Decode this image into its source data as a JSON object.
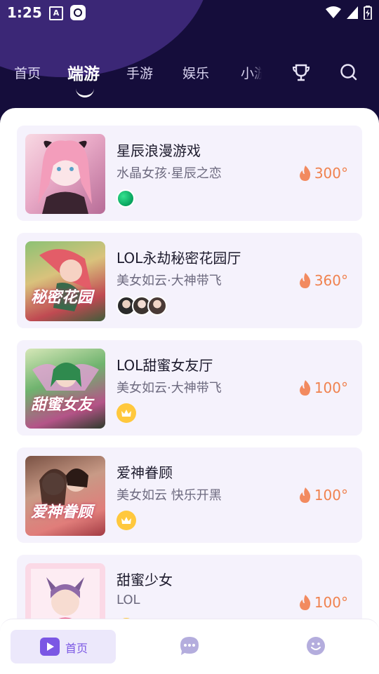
{
  "status_bar": {
    "time": "1:25",
    "app_badge": "A"
  },
  "tabs": [
    {
      "label": "首页",
      "active": false
    },
    {
      "label": "端游",
      "active": true
    },
    {
      "label": "手游",
      "active": false
    },
    {
      "label": "娱乐",
      "active": false
    },
    {
      "label": "小游",
      "active": false
    }
  ],
  "header_icons": [
    "trophy-icon",
    "search-icon"
  ],
  "cards": [
    {
      "title": "星辰浪漫游戏",
      "subtitle": "水晶女孩·星辰之恋",
      "heat": "300°",
      "badge": "green-dot",
      "thumb_colors": [
        "#f4c8d7",
        "#d9a3c7"
      ],
      "thumb_text": ""
    },
    {
      "title": "LOL永劫秘密花园厅",
      "subtitle": "美女如云·大神带飞",
      "heat": "360°",
      "badge": "avatars",
      "thumb_colors": [
        "#7fb06a",
        "#c0524f"
      ],
      "thumb_text": "秘密花园"
    },
    {
      "title": "LOL甜蜜女友厅",
      "subtitle": "美女如云·大神带飞",
      "heat": "100°",
      "badge": "gold-crown",
      "thumb_colors": [
        "#5aa46d",
        "#b4427b"
      ],
      "thumb_text": "甜蜜女友"
    },
    {
      "title": "爱神眷顾",
      "subtitle": "美女如云 快乐开黑",
      "heat": "100°",
      "badge": "gold-crown",
      "thumb_colors": [
        "#6d4237",
        "#d16f6f"
      ],
      "thumb_text": "爱神眷顾"
    },
    {
      "title": "甜蜜少女",
      "subtitle": "LOL",
      "heat": "100°",
      "badge": "gold-crown",
      "thumb_colors": [
        "#f6c6d6",
        "#9f7bc5"
      ],
      "thumb_text": ""
    }
  ],
  "bottom_nav": {
    "home_label": "首页",
    "items": [
      "play-icon",
      "chat-icon",
      "smile-icon"
    ]
  },
  "colors": {
    "header_bg": "#150d3b",
    "accent": "#7b57e4",
    "heat": "#f0824f",
    "card_bg": "#f5f2fc"
  }
}
